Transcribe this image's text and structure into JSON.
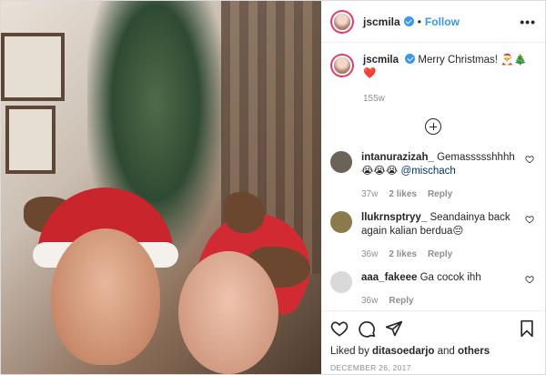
{
  "header": {
    "username": "jscmila",
    "separator": "•",
    "follow_label": "Follow",
    "more_label": "•••"
  },
  "caption": {
    "username": "jscmila",
    "text": "Merry Christmas! 🎅🎄❤️",
    "time": "155w"
  },
  "comments": [
    {
      "username": "intanurazizah_",
      "text": "Gemassssshhhh 😭😭😭 ",
      "mention": "@mischach",
      "time": "37w",
      "likes": "2 likes",
      "reply": "Reply",
      "avatar_color": "#6b6258"
    },
    {
      "username": "llukrnsptryy_",
      "text": "Seandainya back again kalian berdua😔",
      "mention": "",
      "time": "36w",
      "likes": "2 likes",
      "reply": "Reply",
      "avatar_color": "#8a7a4c"
    },
    {
      "username": "aaa_fakeee",
      "text": "Ga cocok ihh",
      "mention": "",
      "time": "36w",
      "likes": "",
      "reply": "Reply",
      "avatar_color": "#d9d9d9"
    }
  ],
  "footer": {
    "liked_prefix": "Liked by ",
    "liked_user": "ditasoedarjo",
    "liked_and": " and ",
    "liked_others": "others",
    "date": "DECEMBER 26, 2017"
  },
  "icons": {
    "like": "heart-icon",
    "comment": "comment-icon",
    "share": "paper-plane-icon",
    "save": "bookmark-icon",
    "verified": "verified-badge-icon",
    "add": "plus-circle-icon"
  },
  "colors": {
    "accent": "#3897f0",
    "verified": "#3897f0",
    "muted": "#8e8e8e"
  }
}
